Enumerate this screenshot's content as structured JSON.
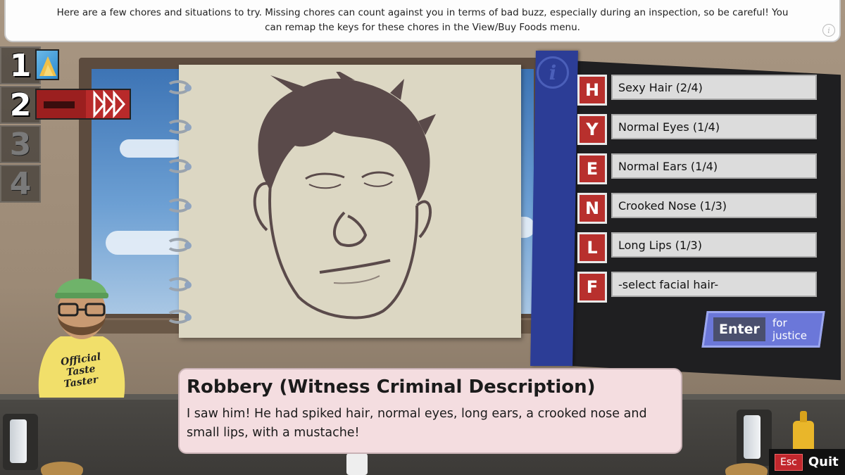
{
  "hint": {
    "text": "Here are a few chores and situations to try. Missing chores can count against you in terms of bad buzz, especially during an inspection, so be careful! You can remap the keys for these chores in the View/Buy Foods menu.",
    "icon": "info-icon"
  },
  "slots": [
    {
      "number": "1",
      "thumb": "nacho-icon",
      "active": true
    },
    {
      "number": "2",
      "thumb": "police-car-icon",
      "active": true
    },
    {
      "number": "3",
      "active": false
    },
    {
      "number": "4",
      "active": false
    }
  ],
  "panel": {
    "info_icon": "i",
    "options": [
      {
        "key": "H",
        "label": "Sexy Hair (2/4)"
      },
      {
        "key": "Y",
        "label": "Normal Eyes (1/4)"
      },
      {
        "key": "E",
        "label": "Normal Ears (1/4)"
      },
      {
        "key": "N",
        "label": "Crooked Nose (1/3)"
      },
      {
        "key": "L",
        "label": "Long Lips (1/3)"
      },
      {
        "key": "F",
        "label": "-select facial hair-"
      }
    ],
    "enter": {
      "key": "Enter",
      "label": "for justice"
    }
  },
  "character": {
    "shirt_text": "Official Taste Taster"
  },
  "dialog": {
    "title": "Robbery (Witness Criminal Description)",
    "body": "I saw him! He had spiked hair, normal eyes, long ears, a crooked nose and small lips, with a mustache!"
  },
  "quit": {
    "key": "Esc",
    "label": "Quit"
  },
  "colors": {
    "key_red": "#b8302d",
    "panel_blue": "#2c3d96",
    "enter_purple": "#6b77d9",
    "dialog_pink": "#f4dde0"
  }
}
